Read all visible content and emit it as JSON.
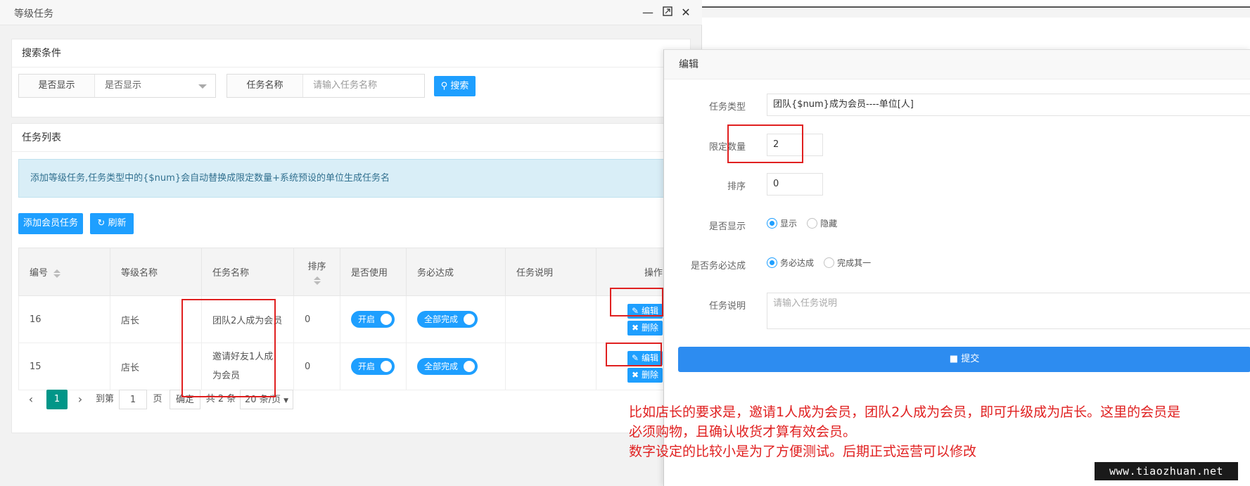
{
  "window": {
    "title": "等级任务"
  },
  "search": {
    "header": "搜索条件",
    "show_label": "是否显示",
    "show_value": "是否显示",
    "name_label": "任务名称",
    "name_placeholder": "请输入任务名称",
    "search_button": "搜索"
  },
  "list": {
    "header": "任务列表",
    "notice": "添加等级任务,任务类型中的{$num}会自动替换成限定数量+系统预设的单位生成任务名",
    "add_button": "添加会员任务",
    "refresh_button": "刷新",
    "columns": [
      "编号",
      "等级名称",
      "任务名称",
      "排序",
      "是否使用",
      "务必达成",
      "任务说明",
      "操作"
    ],
    "rows": [
      {
        "id": "16",
        "level": "店长",
        "task": "团队2人成为会员",
        "sort": "0",
        "use": "开启",
        "must": "全部完成",
        "desc": ""
      },
      {
        "id": "15",
        "level": "店长",
        "task": "邀请好友1人成为会员",
        "sort": "0",
        "use": "开启",
        "must": "全部完成",
        "desc": ""
      }
    ],
    "edit_label": "编辑",
    "delete_label": "删除"
  },
  "pager": {
    "current": "1",
    "goto_prefix": "到第",
    "goto_value": "1",
    "goto_suffix": "页",
    "confirm": "确定",
    "total": "共 2 条",
    "per_page": "20 条/页"
  },
  "dialog": {
    "title": "编辑",
    "type_label": "任务类型",
    "type_value": "团队{$num}成为会员----单位[人]",
    "limit_label": "限定数量",
    "limit_value": "2",
    "sort_label": "排序",
    "sort_value": "0",
    "show_label": "是否显示",
    "show_opt_on": "显示",
    "show_opt_off": "隐藏",
    "must_label": "是否务必达成",
    "must_opt_on": "务必达成",
    "must_opt_off": "完成其一",
    "desc_label": "任务说明",
    "desc_placeholder": "请输入任务说明",
    "submit": "提交"
  },
  "annotation": {
    "line1": "比如店长的要求是，邀请1人成为会员，团队2人成为会员，即可升级成为店长。这里的会员是",
    "line2": "必须购物，且确认收货才算有效会员。",
    "line3": "数字设定的比较小是为了方便测试。后期正式运营可以修改"
  },
  "watermark": "www.tiaozhuan.net",
  "colors": {
    "primary": "#1e9fff",
    "annotation": "#e02020",
    "pager_active": "#009688"
  }
}
